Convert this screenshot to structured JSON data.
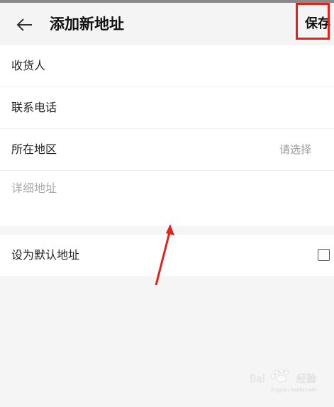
{
  "header": {
    "title": "添加新地址",
    "save_label": "保存",
    "back_icon": "arrow-left-icon"
  },
  "form": {
    "receiver_label": "收货人",
    "phone_label": "联系电话",
    "region_label": "所在地区",
    "region_hint": "请选择",
    "detail_placeholder": "详细地址",
    "default_label": "设为默认地址",
    "default_checked": false
  },
  "annotation": {
    "highlight_color": "#e2231a"
  },
  "watermark": {
    "text": "Bai",
    "icon": "baidu-paw-icon",
    "brand": "经验",
    "sub": "jingyan.baidu.com"
  }
}
